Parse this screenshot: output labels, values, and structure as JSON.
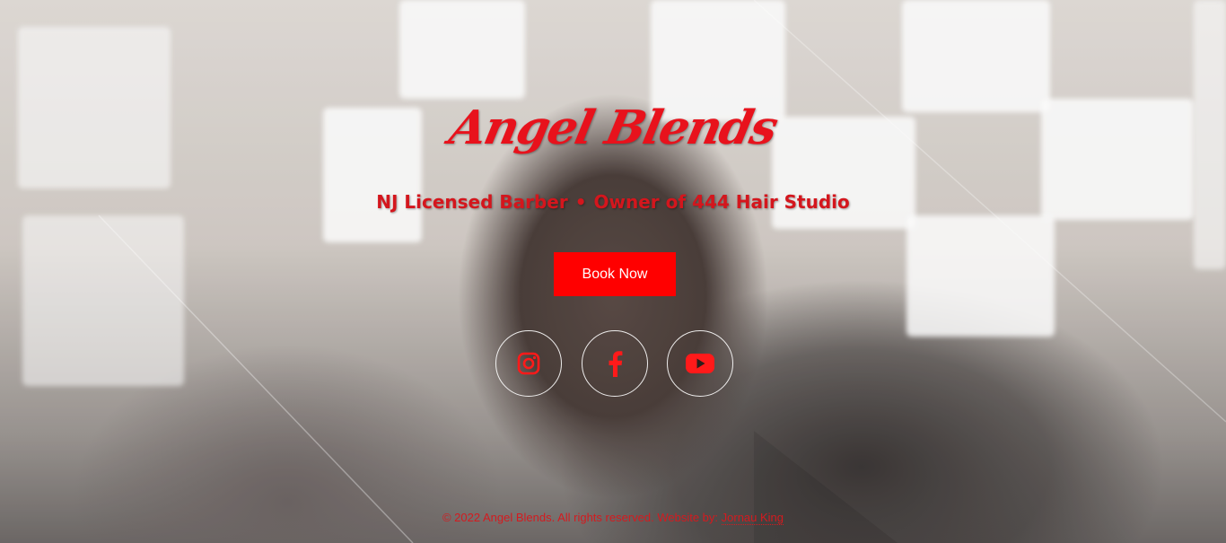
{
  "brand": {
    "logo_text": "Angel Blends",
    "accent_color": "#ff0000"
  },
  "hero": {
    "tagline_left": "NJ Licensed Barber",
    "tagline_sep": "•",
    "tagline_right": "Owner of 444 Hair Studio",
    "cta_label": "Book Now"
  },
  "social": [
    {
      "name": "instagram",
      "icon": "instagram-icon"
    },
    {
      "name": "facebook",
      "icon": "facebook-icon"
    },
    {
      "name": "youtube",
      "icon": "youtube-icon"
    }
  ],
  "footer": {
    "copyright": "© 2022 Angel Blends. All rights reserved. Website by: ",
    "credit_link": "Jornau King"
  }
}
